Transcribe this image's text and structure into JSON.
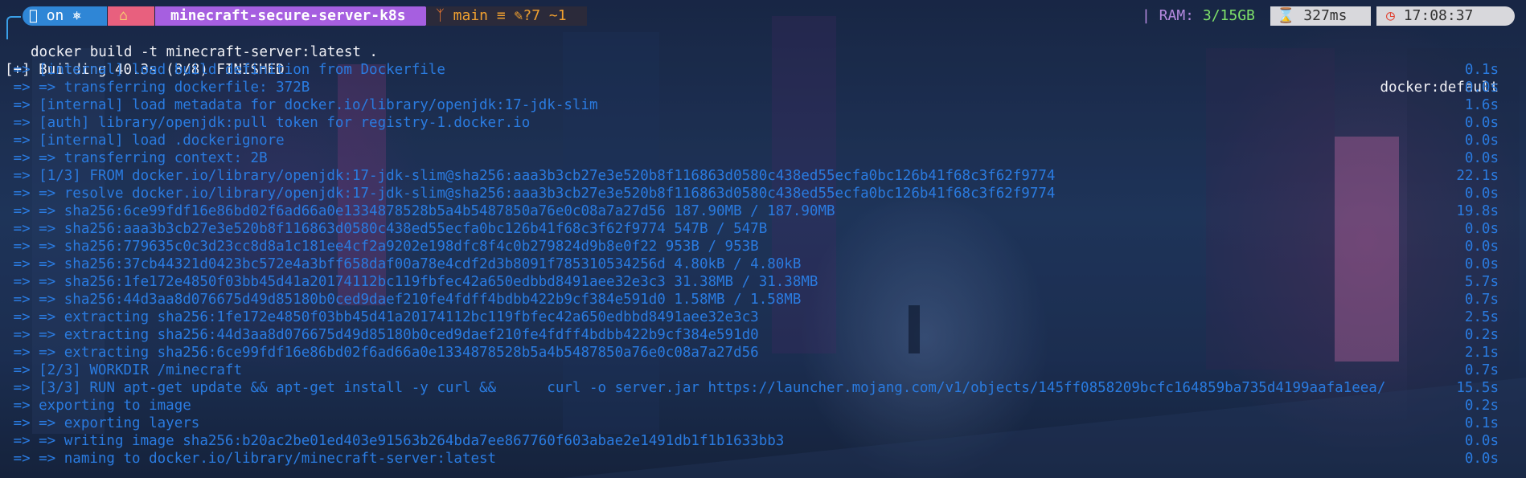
{
  "prompt": {
    "os_text": "on",
    "os_icon": "apple-icon",
    "k8s_icon": "helm-icon",
    "home_icon": "home-icon",
    "directory": "minecraft-secure-server-k8s",
    "git_branch": "main",
    "git_icon": "git-branch-icon",
    "git_status_stash": "≡",
    "git_status_modified": "?7 ~1",
    "ram_label": "| RAM:",
    "ram_value": "3/15GB",
    "exec_time": "327ms",
    "clock": "17:08:37",
    "colors": {
      "os": "#2f86d6",
      "home": "#e8607e",
      "dir": "#a65fe0",
      "git": "#2b2a3a",
      "git_text": "#f0a030",
      "ram_value": "#7ee26a",
      "right_seg": "#d8d8dc"
    }
  },
  "command": "docker build -t minecraft-server:latest .",
  "build": {
    "header": "[+] Building 40.3s (8/8) FINISHED",
    "builder": "docker:default",
    "steps": [
      {
        "text": " => [internal] load build definition from Dockerfile",
        "time": "0.1s"
      },
      {
        "text": " => => transferring dockerfile: 372B",
        "time": "0.0s"
      },
      {
        "text": " => [internal] load metadata for docker.io/library/openjdk:17-jdk-slim",
        "time": "1.6s"
      },
      {
        "text": " => [auth] library/openjdk:pull token for registry-1.docker.io",
        "time": "0.0s"
      },
      {
        "text": " => [internal] load .dockerignore",
        "time": "0.0s"
      },
      {
        "text": " => => transferring context: 2B",
        "time": "0.0s"
      },
      {
        "text": " => [1/3] FROM docker.io/library/openjdk:17-jdk-slim@sha256:aaa3b3cb27e3e520b8f116863d0580c438ed55ecfa0bc126b41f68c3f62f9774",
        "time": "22.1s"
      },
      {
        "text": " => => resolve docker.io/library/openjdk:17-jdk-slim@sha256:aaa3b3cb27e3e520b8f116863d0580c438ed55ecfa0bc126b41f68c3f62f9774",
        "time": "0.0s"
      },
      {
        "text": " => => sha256:6ce99fdf16e86bd02f6ad66a0e1334878528b5a4b5487850a76e0c08a7a27d56 187.90MB / 187.90MB",
        "time": "19.8s"
      },
      {
        "text": " => => sha256:aaa3b3cb27e3e520b8f116863d0580c438ed55ecfa0bc126b41f68c3f62f9774 547B / 547B",
        "time": "0.0s"
      },
      {
        "text": " => => sha256:779635c0c3d23cc8d8a1c181ee4cf2a9202e198dfc8f4c0b279824d9b8e0f22 953B / 953B",
        "time": "0.0s"
      },
      {
        "text": " => => sha256:37cb44321d0423bc572e4a3bff658daf00a78e4cdf2d3b8091f785310534256d 4.80kB / 4.80kB",
        "time": "0.0s"
      },
      {
        "text": " => => sha256:1fe172e4850f03bb45d41a20174112bc119fbfec42a650edbbd8491aee32e3c3 31.38MB / 31.38MB",
        "time": "5.7s"
      },
      {
        "text": " => => sha256:44d3aa8d076675d49d85180b0ced9daef210fe4fdff4bdbb422b9cf384e591d0 1.58MB / 1.58MB",
        "time": "0.7s"
      },
      {
        "text": " => => extracting sha256:1fe172e4850f03bb45d41a20174112bc119fbfec42a650edbbd8491aee32e3c3",
        "time": "2.5s"
      },
      {
        "text": " => => extracting sha256:44d3aa8d076675d49d85180b0ced9daef210fe4fdff4bdbb422b9cf384e591d0",
        "time": "0.2s"
      },
      {
        "text": " => => extracting sha256:6ce99fdf16e86bd02f6ad66a0e1334878528b5a4b5487850a76e0c08a7a27d56",
        "time": "2.1s"
      },
      {
        "text": " => [2/3] WORKDIR /minecraft",
        "time": "0.7s"
      },
      {
        "text": " => [3/3] RUN apt-get update && apt-get install -y curl &&      curl -o server.jar https://launcher.mojang.com/v1/objects/145ff0858209bcfc164859ba735d4199aafa1eea/",
        "time": "15.5s"
      },
      {
        "text": " => exporting to image",
        "time": "0.2s"
      },
      {
        "text": " => => exporting layers",
        "time": "0.1s"
      },
      {
        "text": " => => writing image sha256:b20ac2be01ed403e91563b264bda7ee867760f603abae2e1491db1f1b1633bb3",
        "time": "0.0s"
      },
      {
        "text": " => => naming to docker.io/library/minecraft-server:latest",
        "time": "0.0s"
      }
    ]
  }
}
